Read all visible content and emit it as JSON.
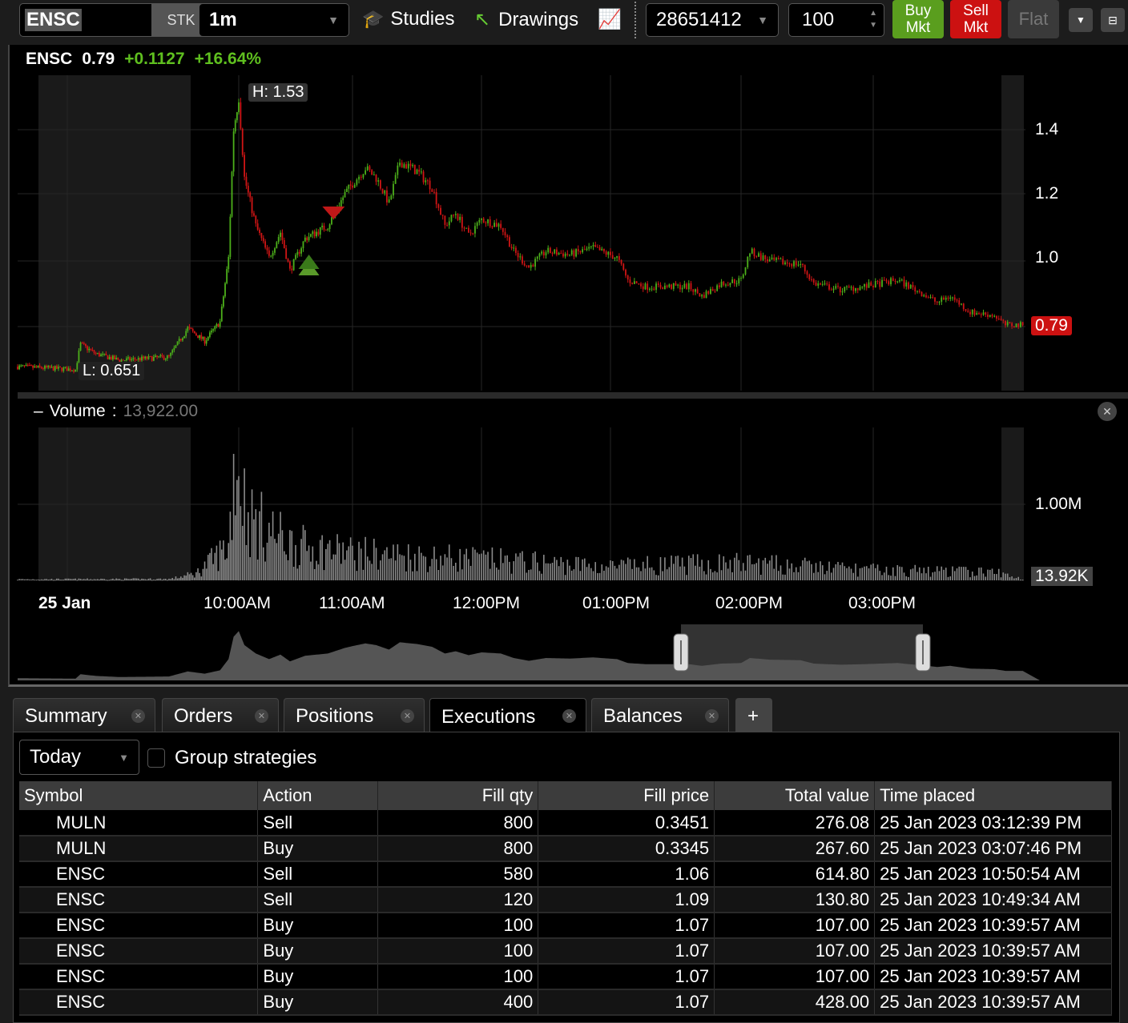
{
  "toolbar": {
    "symbol": "ENSC",
    "sec_type": "STK",
    "interval": "1m",
    "studies": "Studies",
    "drawings": "Drawings",
    "account": "28651412",
    "quantity": "100",
    "buy_line1": "Buy",
    "buy_line2": "Mkt",
    "sell_line1": "Sell",
    "sell_line2": "Mkt",
    "flat": "Flat",
    "colors": {
      "buy": "#5a9e1e",
      "sell": "#cc1111"
    }
  },
  "quote": {
    "symbol": "ENSC",
    "last": "0.79",
    "change": "+0.1127",
    "change_pct": "+16.64%",
    "up_color": "#5fbf1f"
  },
  "price_pane": {
    "high_label": "H: 1.53",
    "low_label": "L: 0.651",
    "last_tag": "0.79",
    "y_ticks": [
      "1.4",
      "1.2",
      "1.0"
    ]
  },
  "volume_pane": {
    "title": "Volume",
    "sep": ":",
    "value": "13,922.00",
    "y_tick": "1.00M",
    "last_tag": "13.92K"
  },
  "time_axis": {
    "date": "25 Jan",
    "labels": [
      "10:00AM",
      "11:00AM",
      "12:00PM",
      "01:00PM",
      "02:00PM",
      "03:00PM"
    ]
  },
  "chart_data": {
    "type": "candlestick",
    "symbol": "ENSC",
    "interval": "1m",
    "ylim": [
      0.6,
      1.6
    ],
    "price_keypoints_minutes_since_midnight": [
      [
        470,
        0.66
      ],
      [
        504,
        0.651
      ],
      [
        507,
        0.73
      ],
      [
        516,
        0.7
      ],
      [
        530,
        0.68
      ],
      [
        559,
        0.69
      ],
      [
        570,
        0.78
      ],
      [
        580,
        0.74
      ],
      [
        589,
        0.8
      ],
      [
        594,
        1.0
      ],
      [
        597,
        1.4
      ],
      [
        600,
        1.5
      ],
      [
        603,
        1.25
      ],
      [
        609,
        1.1
      ],
      [
        616,
        1.0
      ],
      [
        622,
        1.08
      ],
      [
        627,
        0.96
      ],
      [
        635,
        1.06
      ],
      [
        647,
        1.1
      ],
      [
        656,
        1.2
      ],
      [
        666,
        1.28
      ],
      [
        671,
        1.25
      ],
      [
        677,
        1.17
      ],
      [
        682,
        1.3
      ],
      [
        690,
        1.27
      ],
      [
        697,
        1.22
      ],
      [
        703,
        1.1
      ],
      [
        708,
        1.14
      ],
      [
        714,
        1.07
      ],
      [
        720,
        1.12
      ],
      [
        729,
        1.1
      ],
      [
        735,
        1.02
      ],
      [
        742,
        0.97
      ],
      [
        750,
        1.02
      ],
      [
        761,
        1.01
      ],
      [
        772,
        1.03
      ],
      [
        783,
        1.0
      ],
      [
        788,
        0.93
      ],
      [
        796,
        0.91
      ],
      [
        816,
        0.91
      ],
      [
        822,
        0.88
      ],
      [
        831,
        0.92
      ],
      [
        840,
        0.93
      ],
      [
        844,
        1.02
      ],
      [
        853,
        0.99
      ],
      [
        867,
        0.98
      ],
      [
        873,
        0.92
      ],
      [
        885,
        0.9
      ],
      [
        896,
        0.91
      ],
      [
        911,
        0.93
      ],
      [
        922,
        0.89
      ],
      [
        929,
        0.86
      ],
      [
        935,
        0.88
      ],
      [
        944,
        0.83
      ],
      [
        955,
        0.82
      ],
      [
        960,
        0.79
      ],
      [
        968,
        0.79
      ]
    ],
    "volume_keypoints_K": [
      [
        470,
        15
      ],
      [
        560,
        20
      ],
      [
        575,
        100
      ],
      [
        594,
        500
      ],
      [
        598,
        1900
      ],
      [
        605,
        900
      ],
      [
        630,
        500
      ],
      [
        660,
        400
      ],
      [
        720,
        300
      ],
      [
        780,
        200
      ],
      [
        840,
        250
      ],
      [
        900,
        150
      ],
      [
        955,
        120
      ],
      [
        968,
        20
      ]
    ],
    "markers": [
      {
        "type": "sell",
        "time_min": 650,
        "price": 1.14
      },
      {
        "type": "buy",
        "time_min": 637,
        "price": 0.97
      },
      {
        "type": "buy",
        "time_min": 637,
        "price": 0.99
      }
    ]
  },
  "tabs": [
    {
      "label": "Summary"
    },
    {
      "label": "Orders"
    },
    {
      "label": "Positions"
    },
    {
      "label": "Executions",
      "active": true
    },
    {
      "label": "Balances"
    }
  ],
  "tab_add": "+",
  "filters": {
    "period": "Today",
    "group_label": "Group strategies"
  },
  "table": {
    "columns": [
      "Symbol",
      "Action",
      "Fill qty",
      "Fill price",
      "Total value",
      "Time placed"
    ],
    "rows": [
      [
        "MULN",
        "Sell",
        "800",
        "0.3451",
        "276.08",
        "25 Jan 2023 03:12:39 PM"
      ],
      [
        "MULN",
        "Buy",
        "800",
        "0.3345",
        "267.60",
        "25 Jan 2023 03:07:46 PM"
      ],
      [
        "ENSC",
        "Sell",
        "580",
        "1.06",
        "614.80",
        "25 Jan 2023 10:50:54 AM"
      ],
      [
        "ENSC",
        "Sell",
        "120",
        "1.09",
        "130.80",
        "25 Jan 2023 10:49:34 AM"
      ],
      [
        "ENSC",
        "Buy",
        "100",
        "1.07",
        "107.00",
        "25 Jan 2023 10:39:57 AM"
      ],
      [
        "ENSC",
        "Buy",
        "100",
        "1.07",
        "107.00",
        "25 Jan 2023 10:39:57 AM"
      ],
      [
        "ENSC",
        "Buy",
        "100",
        "1.07",
        "107.00",
        "25 Jan 2023 10:39:57 AM"
      ],
      [
        "ENSC",
        "Buy",
        "400",
        "1.07",
        "428.00",
        "25 Jan 2023 10:39:57 AM"
      ]
    ]
  }
}
